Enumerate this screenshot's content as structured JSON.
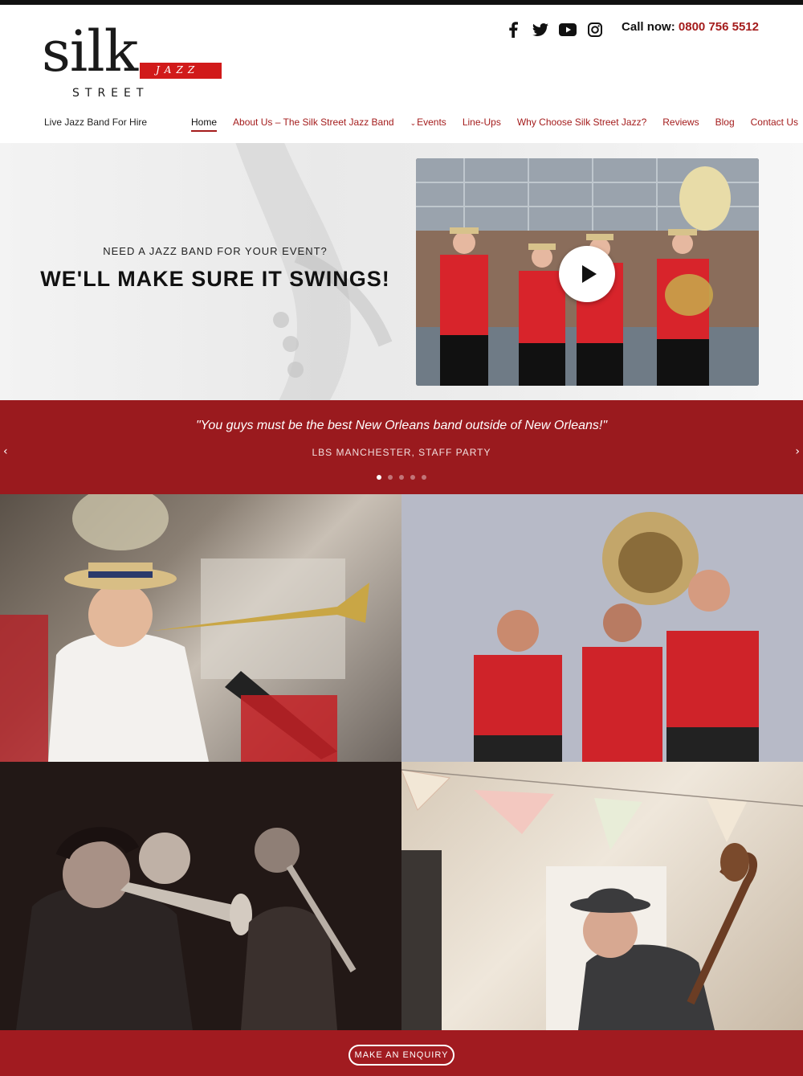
{
  "header": {
    "logo": {
      "word1": "silk",
      "word2": "JAZZ",
      "word3": "STREET"
    },
    "tagline": "Live Jazz Band For Hire",
    "call_label": "Call now:",
    "call_number": "0800 756 5512",
    "social": [
      "facebook-icon",
      "twitter-icon",
      "youtube-icon",
      "instagram-icon"
    ]
  },
  "nav": {
    "items": [
      {
        "label": "Home",
        "active": true
      },
      {
        "label": "About Us – The Silk Street Jazz Band"
      },
      {
        "label": "Events",
        "has_dropdown": true
      },
      {
        "label": "Line-Ups"
      },
      {
        "label": "Why Choose Silk Street Jazz?"
      },
      {
        "label": "Reviews"
      },
      {
        "label": "Blog"
      },
      {
        "label": "Contact Us"
      }
    ]
  },
  "hero": {
    "kicker": "NEED A JAZZ BAND FOR YOUR EVENT?",
    "headline": "WE'LL MAKE SURE IT SWINGS!"
  },
  "testimonial": {
    "quote": "\"You guys must be the best New Orleans band outside of New Orleans!\"",
    "cite": "LBS MANCHESTER, STAFF PARTY",
    "slide_count": 5,
    "active_slide": 1
  },
  "cta": {
    "label": "MAKE AN ENQUIRY"
  },
  "colors": {
    "brand_red": "#a41c1c",
    "band_red": "#9a1a1e",
    "logo_red": "#d11a1a"
  }
}
